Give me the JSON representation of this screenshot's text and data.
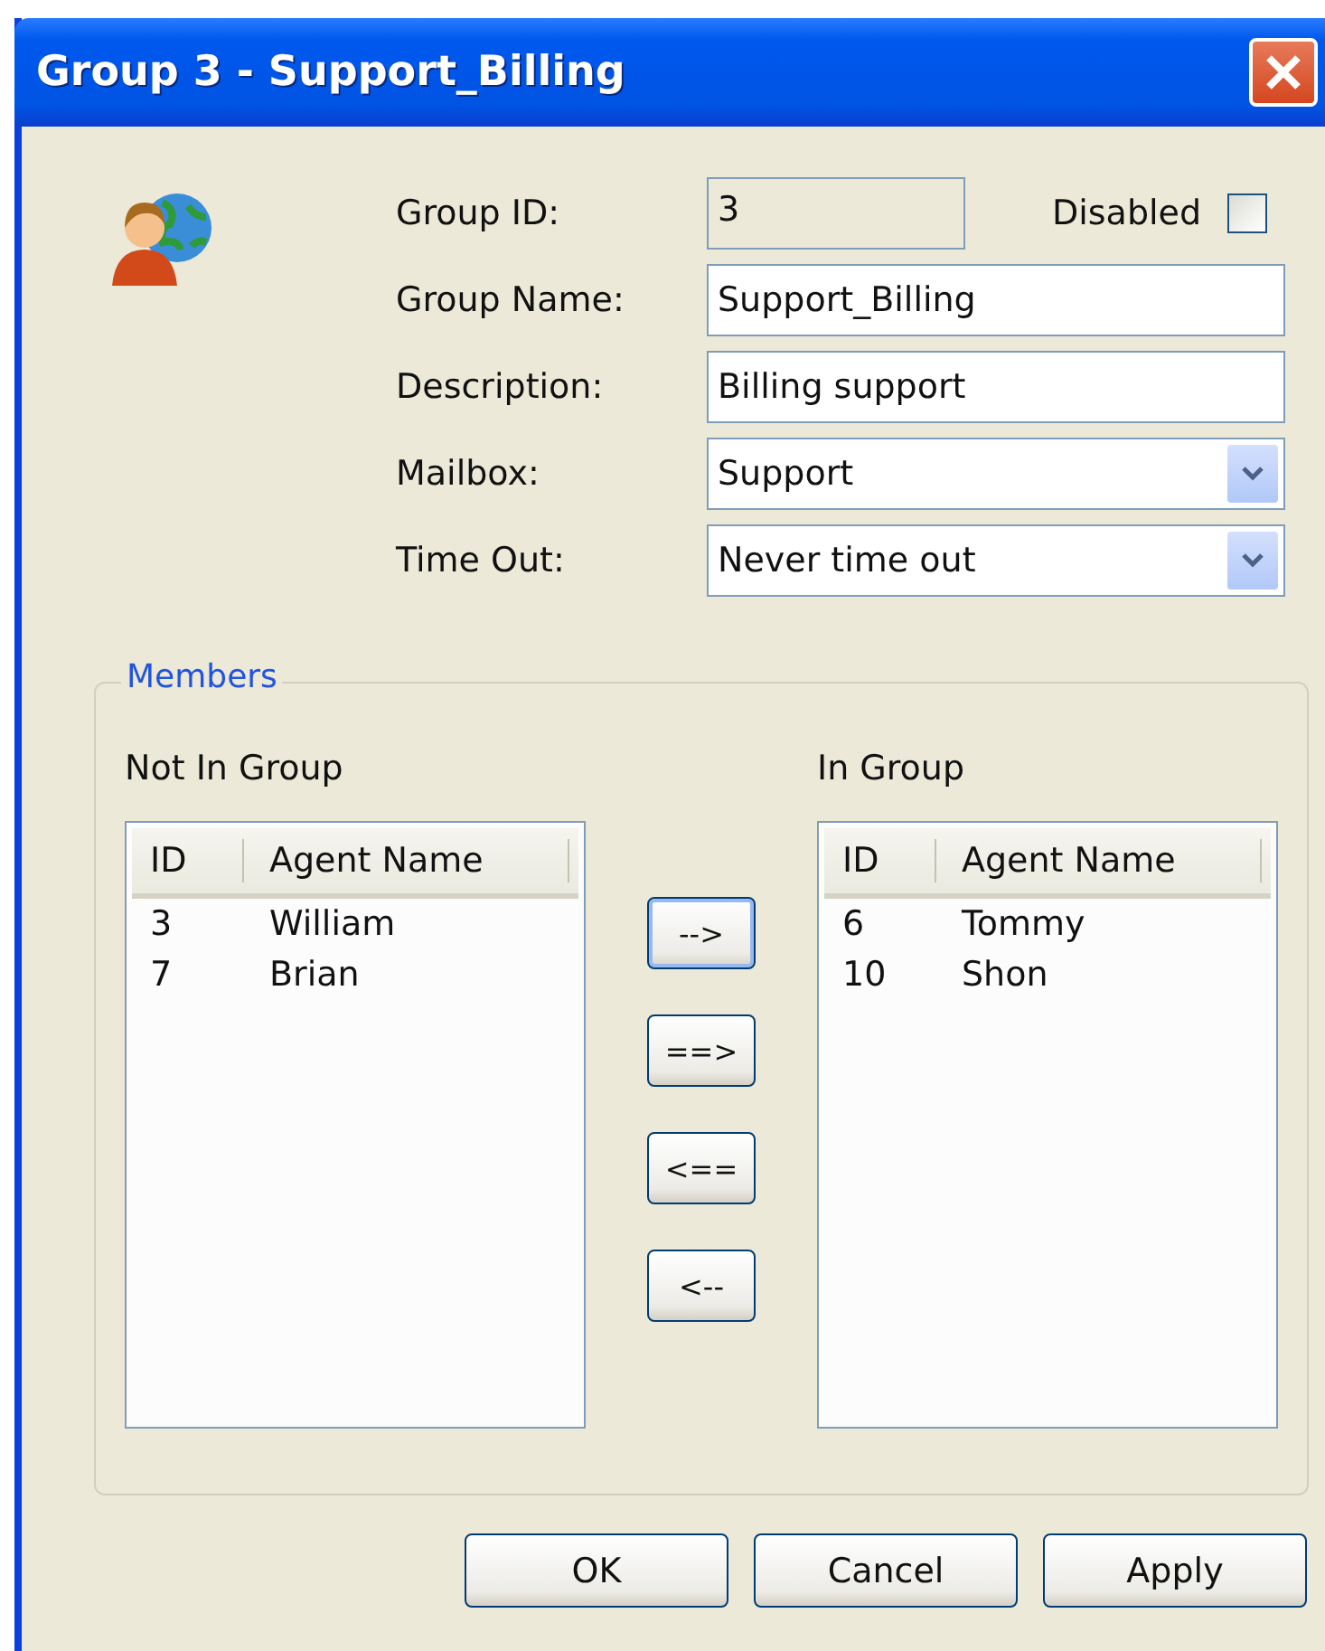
{
  "window": {
    "title": "Group 3 - Support_Billing"
  },
  "fields": [
    {
      "label": "Group ID:",
      "value": "3",
      "kind": "readonly"
    },
    {
      "label": "Group Name:",
      "value": "Support_Billing",
      "kind": "text"
    },
    {
      "label": "Description:",
      "value": "Billing support",
      "kind": "text"
    },
    {
      "label": "Mailbox:",
      "value": "Support",
      "kind": "dropdown"
    },
    {
      "label": "Time Out:",
      "value": "Never time out",
      "kind": "dropdown"
    }
  ],
  "disabled": {
    "label": "Disabled",
    "checked": false
  },
  "members": {
    "title": "Members",
    "not_in_group": {
      "label": "Not In Group",
      "columns": [
        "ID",
        "Agent Name"
      ],
      "rows": [
        [
          "3",
          "William"
        ],
        [
          "7",
          "Brian"
        ]
      ]
    },
    "in_group": {
      "label": "In Group",
      "columns": [
        "ID",
        "Agent Name"
      ],
      "rows": [
        [
          "6",
          "Tommy"
        ],
        [
          "10",
          "Shon"
        ]
      ]
    },
    "move_buttons": [
      {
        "label": "-->",
        "focused": true
      },
      {
        "label": "==>",
        "focused": false
      },
      {
        "label": "<==",
        "focused": false
      },
      {
        "label": "<--",
        "focused": false
      }
    ]
  },
  "buttons": [
    "OK",
    "Cancel",
    "Apply"
  ]
}
